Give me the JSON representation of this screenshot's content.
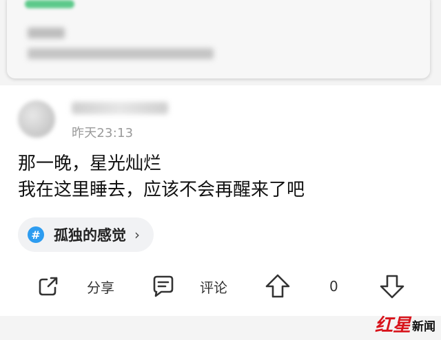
{
  "post": {
    "time": "昨天23:13",
    "text_lines": [
      "那一晚，星光灿烂",
      "我在这里睡去，应该不会再醒来了吧"
    ]
  },
  "topic": {
    "label": "孤独的感觉",
    "icon": "hash-icon",
    "chevron": "›"
  },
  "actions": {
    "share_label": "分享",
    "comment_label": "评论",
    "upvote_count": "0"
  },
  "icons": {
    "share": "share-icon",
    "comment": "comment-icon",
    "upvote": "upvote-icon",
    "downvote": "downvote-icon"
  },
  "watermark": {
    "red": "红星",
    "black": "新闻"
  },
  "colors": {
    "topic_hash": "#2d9cf0",
    "watermark_red": "#d8131b",
    "time_gray": "#9a9a9a"
  }
}
